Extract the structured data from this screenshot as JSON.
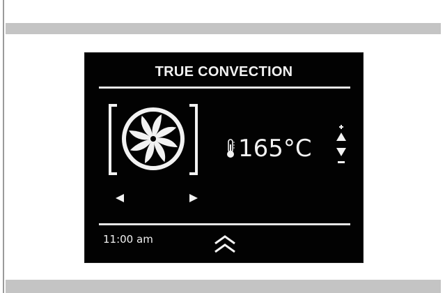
{
  "display": {
    "mode_title": "TRUE CONVECTION",
    "temperature": "165°C",
    "time": "11:00 am"
  },
  "icons": {
    "mode": "fan-icon",
    "prev": "triangle-left-icon",
    "next": "triangle-right-icon",
    "temperature": "thermometer-icon",
    "increase": "plus-up-icon",
    "decrease": "minus-down-icon",
    "menu": "double-chevron-up-icon"
  },
  "colors": {
    "screen_background": "#020202",
    "foreground": "#f2f2f2",
    "frame_bars": "#c4c4c4"
  }
}
